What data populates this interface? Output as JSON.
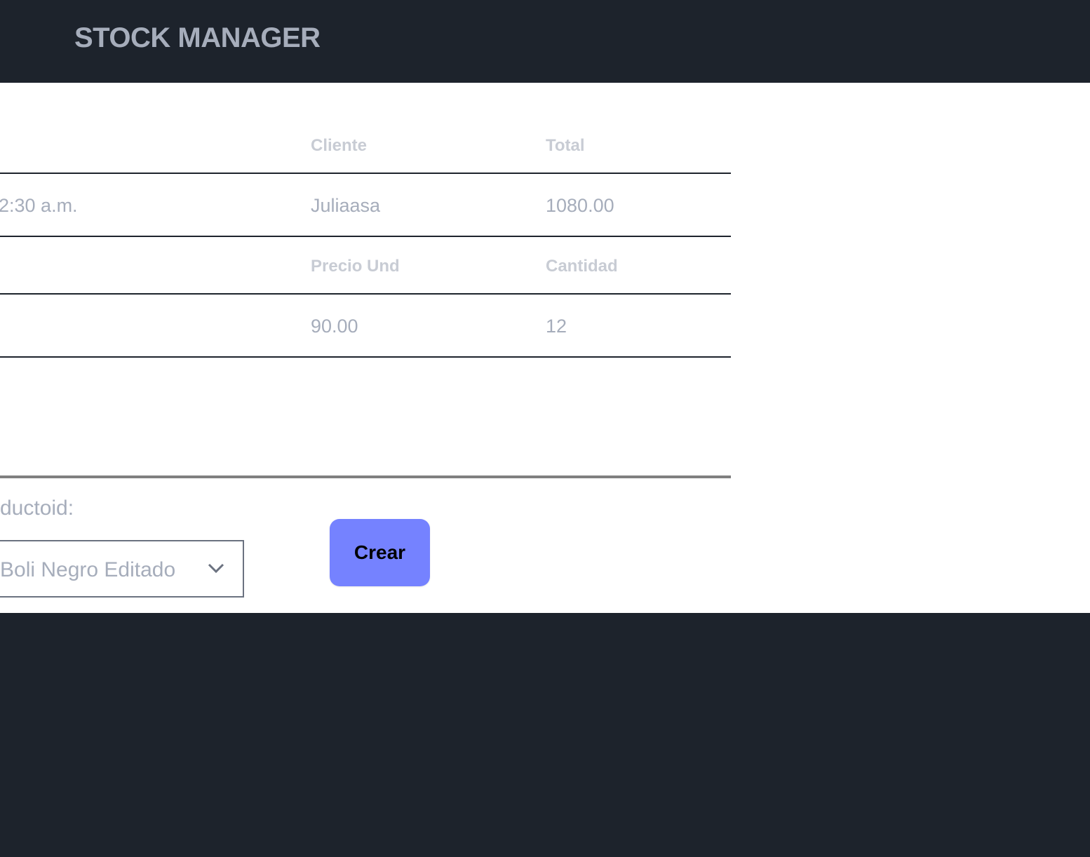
{
  "header": {
    "title": "STOCK MANAGER"
  },
  "sale_table": {
    "headers": [
      "Cliente",
      "Total"
    ],
    "row": {
      "date_fragment": "2:30 a.m.",
      "client": "Juliaasa",
      "total": "1080.00"
    }
  },
  "detail_table": {
    "headers": [
      "Precio Und",
      "Cantidad"
    ],
    "row": {
      "price": "90.00",
      "quantity": "12"
    }
  },
  "form": {
    "product_label": "ductoid:",
    "product_select_value": "Boli Negro Editado",
    "create_button": "Crear"
  },
  "colors": {
    "background": "#1d232c",
    "accent": "#7582ff",
    "text_muted": "#a6adbb"
  },
  "icons": {
    "select": "chevron-down-icon"
  }
}
